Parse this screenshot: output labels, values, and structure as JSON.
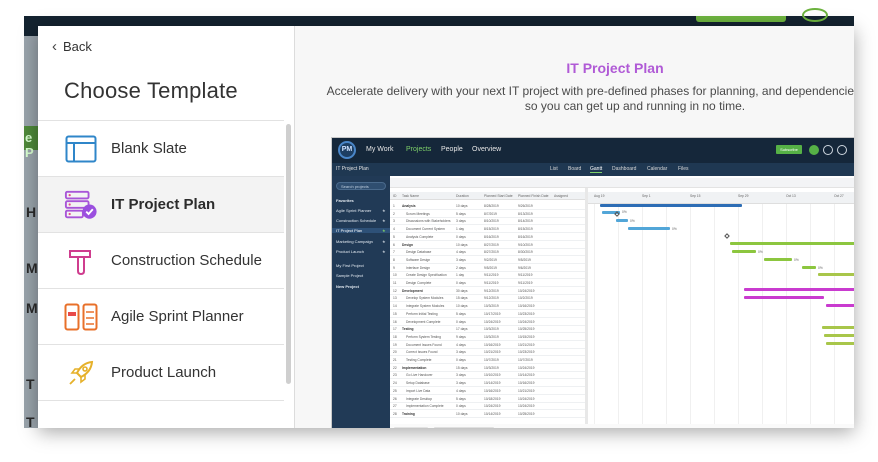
{
  "modal": {
    "back_label": "Back",
    "title": "Choose Template"
  },
  "templates": [
    {
      "label": "Blank Slate",
      "icon": "window-icon",
      "selected": false
    },
    {
      "label": "IT Project Plan",
      "icon": "server-check-icon",
      "selected": true
    },
    {
      "label": "Construction Schedule",
      "icon": "hammer-icon",
      "selected": false
    },
    {
      "label": "Agile Sprint Planner",
      "icon": "kanban-icon",
      "selected": false
    },
    {
      "label": "Product Launch",
      "icon": "rocket-icon",
      "selected": false
    }
  ],
  "detail": {
    "title": "IT Project Plan",
    "description": "Accelerate delivery with your next IT project with pre-defined phases for planning, and dependencies between tasks, so you can get up and running in no time."
  },
  "background_fragments": [
    "H",
    "M",
    "M",
    "T",
    "T"
  ],
  "background_green_fragment": "e P",
  "preview": {
    "logo": "PM",
    "nav": [
      "My Work",
      "Projects",
      "People",
      "Overview"
    ],
    "subscribe": "Subscribe",
    "project_name": "IT Project Plan",
    "tabs": [
      "List",
      "Board",
      "Gantt",
      "Dashboard",
      "Calendar",
      "Files"
    ],
    "search_placeholder": "Search projects",
    "favorites_label": "Favorites",
    "sidebar_projects": [
      "Agile Sprint Planner",
      "Construction Schedule",
      "IT Project Plan",
      "Marketing Campaign",
      "Product Launch",
      "My First Project",
      "Sample Project"
    ],
    "new_project": "New Project",
    "columns": [
      "ID",
      "Task Name",
      "Duration",
      "Planned Start Date",
      "Planned Finish Date",
      "Assigned"
    ],
    "rows": [
      [
        "1",
        "Analysis",
        "10 days",
        "8/28/2019",
        "9/26/2019"
      ],
      [
        "2",
        "Scrum Meetings",
        "5 days",
        "8/7/2019",
        "8/13/2019"
      ],
      [
        "3",
        "Discussions with Stakeholders",
        "3 days",
        "8/10/2019",
        "8/14/2019"
      ],
      [
        "4",
        "Document Current System",
        "1 day",
        "8/15/2019",
        "8/15/2019"
      ],
      [
        "5",
        "Analysis Complete",
        "0 days",
        "8/16/2019",
        "8/16/2019"
      ],
      [
        "6",
        "Design",
        "10 days",
        "8/27/2019",
        "9/10/2019"
      ],
      [
        "7",
        "Design Database",
        "4 days",
        "8/27/2019",
        "8/30/2019"
      ],
      [
        "8",
        "Software Design",
        "3 days",
        "9/2/2019",
        "9/5/2019"
      ],
      [
        "9",
        "Interface Design",
        "2 days",
        "9/5/2019",
        "9/6/2019"
      ],
      [
        "10",
        "Create Design Specification",
        "1 day",
        "9/11/2019",
        "9/11/2019"
      ],
      [
        "11",
        "Design Complete",
        "0 days",
        "9/11/2019",
        "9/11/2019"
      ],
      [
        "12",
        "Development",
        "30 days",
        "9/12/2019",
        "10/24/2019"
      ],
      [
        "13",
        "Develop System Modules",
        "15 days",
        "9/12/2019",
        "10/2/2019"
      ],
      [
        "14",
        "Integrate System Modules",
        "10 days",
        "10/3/2019",
        "10/16/2019"
      ],
      [
        "15",
        "Perform Initial Testing",
        "5 days",
        "10/17/2019",
        "10/23/2019"
      ],
      [
        "16",
        "Development Complete",
        "0 days",
        "10/24/2019",
        "10/24/2019"
      ],
      [
        "17",
        "Testing",
        "17 days",
        "10/3/2019",
        "10/25/2019"
      ],
      [
        "18",
        "Perform System Testing",
        "9 days",
        "10/3/2019",
        "10/15/2019"
      ],
      [
        "19",
        "Document Issues Found",
        "4 days",
        "10/16/2019",
        "10/21/2019"
      ],
      [
        "20",
        "Correct Issues Found",
        "3 days",
        "10/21/2019",
        "10/23/2019"
      ],
      [
        "21",
        "Testing Complete",
        "0 days",
        "10/7/2019",
        "10/7/2019"
      ],
      [
        "22",
        "Implementation",
        "15 days",
        "10/3/2019",
        "10/24/2019"
      ],
      [
        "23",
        "Go Live Handover",
        "3 days",
        "10/10/2019",
        "10/14/2019"
      ],
      [
        "24",
        "Setup Database",
        "3 days",
        "10/14/2019",
        "10/16/2019"
      ],
      [
        "25",
        "Import Live Data",
        "4 days",
        "10/16/2019",
        "10/21/2019"
      ],
      [
        "26",
        "Integrate Desktop",
        "5 days",
        "10/18/2019",
        "10/24/2019"
      ],
      [
        "27",
        "Implementation Complete",
        "0 days",
        "10/24/2019",
        "10/24/2019"
      ],
      [
        "28",
        "Training",
        "10 days",
        "10/14/2019",
        "10/25/2019"
      ]
    ],
    "gantt_months": [
      "Aug 19",
      "Sep 1",
      "Sep 15",
      "Sep 29",
      "Oct 13",
      "Oct 27"
    ],
    "gantt_pct_labels": [
      "0%",
      "0%",
      "0%",
      "0%",
      "0%",
      "0%"
    ]
  },
  "colors": {
    "accent_purple": "#b05ad6",
    "preview_nav": "#15273a",
    "gantt_blue": "#2d6db5",
    "gantt_lightblue": "#52a6d8",
    "gantt_green": "#8cc63f",
    "gantt_magenta": "#c93bcf",
    "gantt_olive": "#a8c64a"
  }
}
